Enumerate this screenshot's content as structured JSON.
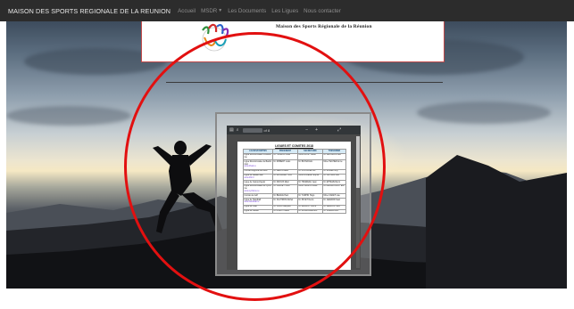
{
  "navbar": {
    "brand": "MAISON DES SPORTS REGIONALE DE LA REUNION",
    "items": [
      {
        "label": "Accueil",
        "has_dropdown": false
      },
      {
        "label": "MSDR",
        "has_dropdown": true
      },
      {
        "label": "Les Documents",
        "has_dropdown": false
      },
      {
        "label": "Les Ligues",
        "has_dropdown": false
      },
      {
        "label": "Nous contacter",
        "has_dropdown": false
      }
    ],
    "background": "#2c2c2c"
  },
  "header": {
    "title": "Maison des Sports Régionale de la Réunion",
    "border_color": "#c24a4a"
  },
  "pdf_viewer": {
    "toolbar": {
      "page_of": "of 8",
      "zoom_out": "−",
      "zoom_in": "+",
      "icons": [
        "sidebar-icon",
        "search-icon",
        "expand-icon"
      ]
    },
    "document": {
      "title": "LIGUES ET COMITES 2018",
      "columns": [
        "LIGUES/COMITES",
        "PRESIDENT",
        "SECRETAIRE",
        "TRESORIER"
      ],
      "rows": [
        {
          "name": "Ligue Réunionnaise d'Athlétisme",
          "link": "",
          "cells": [
            "M. HOARAU Jean",
            "Mme PAYET Marie",
            "M. GRONDIN Paul"
          ]
        },
        {
          "name": "Ligue Réunionnaise de Badminton",
          "link": "www.lrbad.re",
          "cells": [
            "M. ROBERT Louis",
            "M. BOYER Eric",
            "Mme TECHER Anne"
          ]
        },
        {
          "name": "Comité Régional de Boxe",
          "link": "",
          "cells": [
            "M. LEBON Alain",
            "M. FONTAINE Luc",
            "M. MOREL Guy"
          ]
        },
        {
          "name": "Ligue de Basket-Ball",
          "link": "www.lrbb.fr",
          "cells": [
            "M. MUSSARD Yves",
            "Mme RIVIERE Sophie",
            "M. NATIVEL Joël"
          ]
        },
        {
          "name": "Ligue de Canoë-Kayak",
          "link": "",
          "cells": [
            "M. DIJOUX Marc",
            "M. HOAREAU Jean",
            "M. ETHEVE Rémi"
          ]
        },
        {
          "name": "Ligue Réunionnaise de Cyclisme",
          "link": "www.cyclisme.re",
          "cells": [
            "M. LAURET Henri",
            "Mme VIRAPIN Rose",
            "M. ABLANCOURT Eric"
          ]
        },
        {
          "name": "Comité de Golf",
          "link": "",
          "cells": [
            "M. BEGUE Paul",
            "M. TURPIN Hugo",
            "Mme CADET Lise"
          ]
        },
        {
          "name": "Ligue de Handball",
          "link": "www.handball.re",
          "cells": [
            "M. SAUTRON Michel",
            "M. PAYET Denis",
            "M. GERARD Noël"
          ]
        },
        {
          "name": "Ligue de Judo",
          "link": "",
          "cells": [
            "M. CLAIN Jacques",
            "M. MAILLOT Pierre",
            "M. LEGROS Yann"
          ]
        },
        {
          "name": "Ligue de Karaté",
          "link": "",
          "cells": [
            "M. ASSATI Gilles",
            "M. BOURDAGE Eric",
            "M. SINAMA Loïc"
          ]
        }
      ]
    }
  },
  "annotation": {
    "circle_color": "#e21010"
  }
}
